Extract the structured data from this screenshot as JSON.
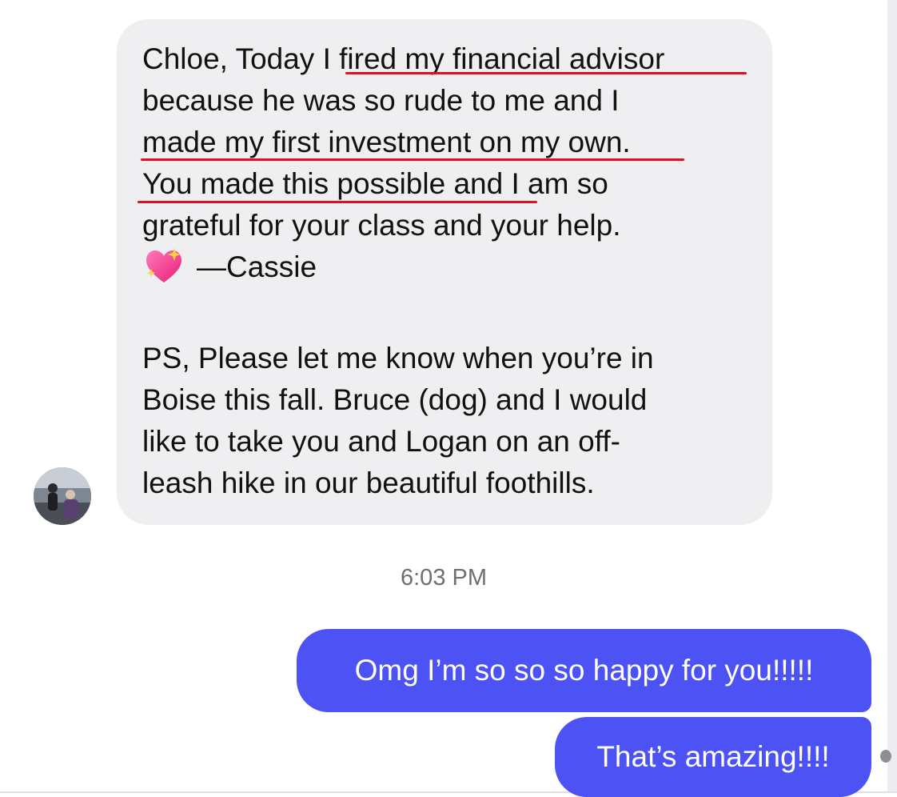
{
  "conversation": {
    "incoming_message": {
      "lines": [
        "Chloe, Today I fired my financial advisor",
        "because he was so rude to me and I",
        "made my first investment on my own.",
        "You made this possible and I am so",
        "grateful for your class and your help.",
        "—Cassie",
        "PS, Please let me know when you’re in",
        "Boise this fall. Bruce (dog) and I would",
        "like to take you and Logan on an off-",
        "leash hike in our beautiful foothills."
      ],
      "emoji": "sparkling-heart-icon",
      "highlight_color": "#e0101e"
    },
    "timestamp": "6:03 PM",
    "outgoing_messages": [
      "Omg I’m so so so happy for you!!!!!",
      "That’s amazing!!!!"
    ]
  },
  "colors": {
    "incoming_bubble": "#efeff1",
    "outgoing_bubble": "#4d52f5",
    "timestamp_text": "#6e6e73"
  }
}
